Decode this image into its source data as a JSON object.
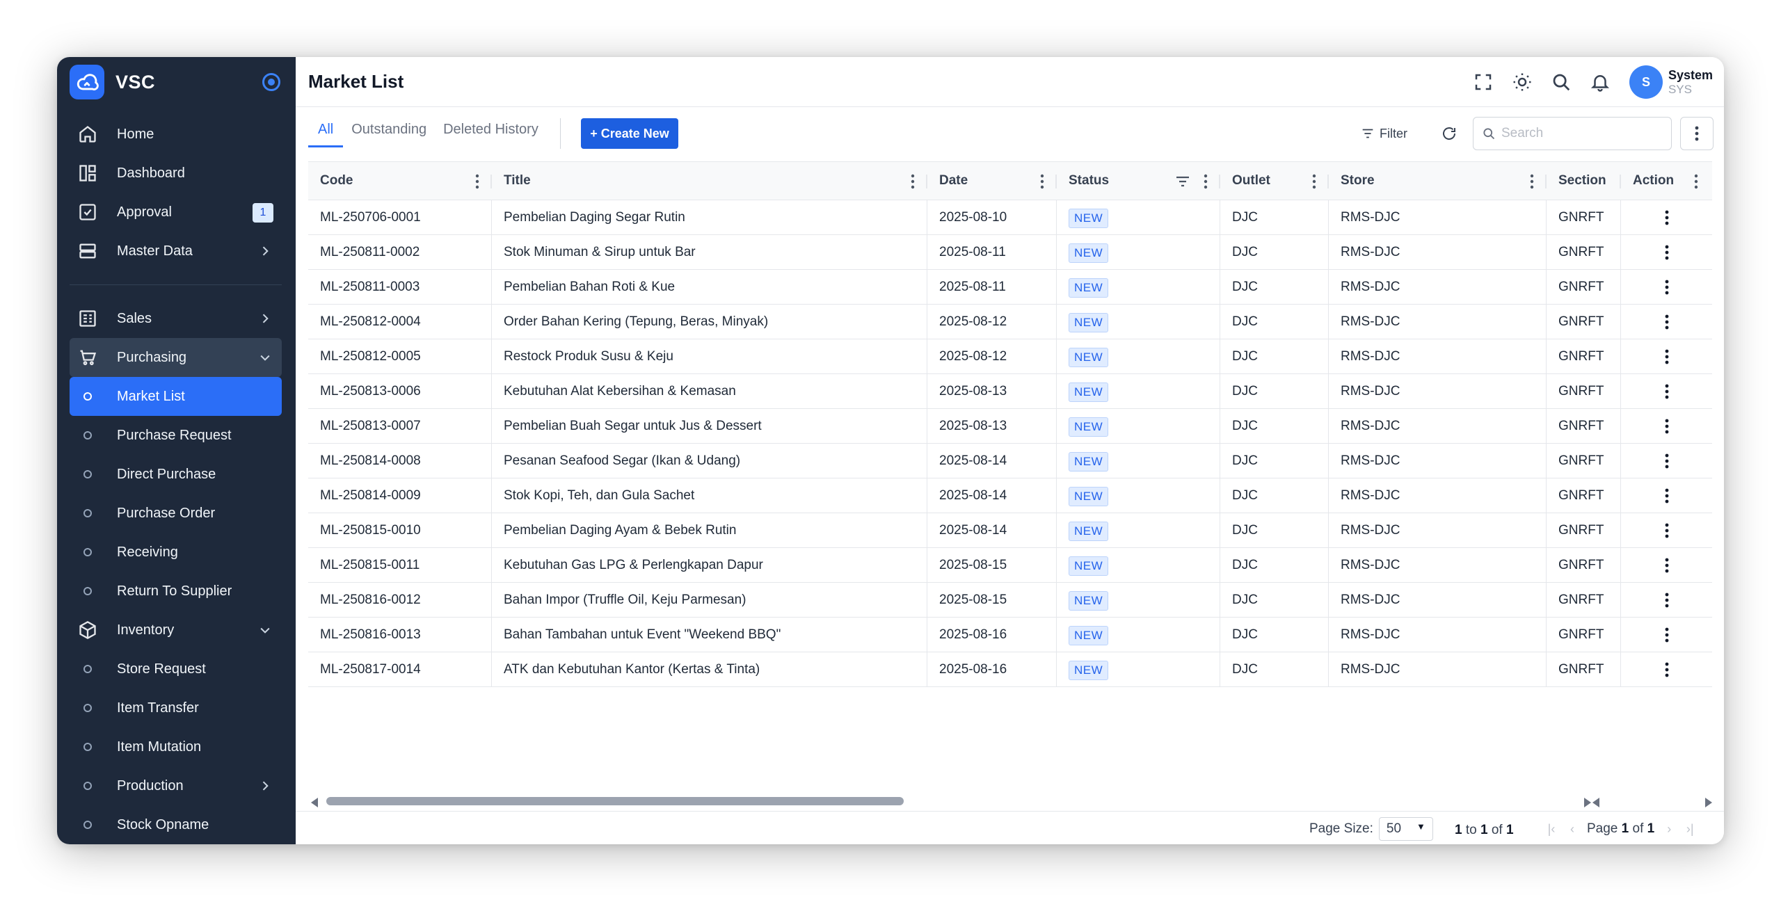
{
  "brand": {
    "name": "VSC"
  },
  "sidebar": {
    "items": [
      {
        "label": "Home",
        "icon": "home-icon"
      },
      {
        "label": "Dashboard",
        "icon": "dashboard-icon"
      },
      {
        "label": "Approval",
        "icon": "approval-icon",
        "badge": "1"
      },
      {
        "label": "Master Data",
        "icon": "database-icon"
      },
      {
        "label": "Sales",
        "icon": "sales-icon"
      },
      {
        "label": "Purchasing",
        "icon": "cart-icon"
      },
      {
        "label": "Market List"
      },
      {
        "label": "Purchase Request"
      },
      {
        "label": "Direct Purchase"
      },
      {
        "label": "Purchase Order"
      },
      {
        "label": "Receiving"
      },
      {
        "label": "Return To Supplier"
      },
      {
        "label": "Inventory",
        "icon": "box-icon"
      },
      {
        "label": "Store Request"
      },
      {
        "label": "Item Transfer"
      },
      {
        "label": "Item Mutation"
      },
      {
        "label": "Production"
      },
      {
        "label": "Stock Opname"
      }
    ]
  },
  "header": {
    "title": "Market List"
  },
  "user": {
    "initial": "S",
    "name": "System",
    "code": "SYS"
  },
  "tabs": [
    {
      "label": "All"
    },
    {
      "label": "Outstanding"
    },
    {
      "label": "Deleted History"
    }
  ],
  "toolbar": {
    "create_label": "+ Create New",
    "filter_label": "Filter",
    "search_placeholder": "Search"
  },
  "grid": {
    "columns": [
      "Code",
      "Title",
      "Date",
      "Status",
      "Outlet",
      "Store",
      "Section",
      "Action"
    ],
    "rows": [
      {
        "code": "ML-250706-0001",
        "title": "Pembelian Daging Segar Rutin",
        "date": "2025-08-10",
        "status": "NEW",
        "outlet": "DJC",
        "store": "RMS-DJC",
        "section": "GNRFT"
      },
      {
        "code": "ML-250811-0002",
        "title": "Stok Minuman & Sirup untuk Bar",
        "date": "2025-08-11",
        "status": "NEW",
        "outlet": "DJC",
        "store": "RMS-DJC",
        "section": "GNRFT"
      },
      {
        "code": "ML-250811-0003",
        "title": "Pembelian Bahan Roti & Kue",
        "date": "2025-08-11",
        "status": "NEW",
        "outlet": "DJC",
        "store": "RMS-DJC",
        "section": "GNRFT"
      },
      {
        "code": "ML-250812-0004",
        "title": "Order Bahan Kering (Tepung, Beras, Minyak)",
        "date": "2025-08-12",
        "status": "NEW",
        "outlet": "DJC",
        "store": "RMS-DJC",
        "section": "GNRFT"
      },
      {
        "code": "ML-250812-0005",
        "title": "Restock Produk Susu & Keju",
        "date": "2025-08-12",
        "status": "NEW",
        "outlet": "DJC",
        "store": "RMS-DJC",
        "section": "GNRFT"
      },
      {
        "code": "ML-250813-0006",
        "title": "Kebutuhan Alat Kebersihan & Kemasan",
        "date": "2025-08-13",
        "status": "NEW",
        "outlet": "DJC",
        "store": "RMS-DJC",
        "section": "GNRFT"
      },
      {
        "code": "ML-250813-0007",
        "title": "Pembelian Buah Segar untuk Jus & Dessert",
        "date": "2025-08-13",
        "status": "NEW",
        "outlet": "DJC",
        "store": "RMS-DJC",
        "section": "GNRFT"
      },
      {
        "code": "ML-250814-0008",
        "title": "Pesanan Seafood Segar (Ikan & Udang)",
        "date": "2025-08-14",
        "status": "NEW",
        "outlet": "DJC",
        "store": "RMS-DJC",
        "section": "GNRFT"
      },
      {
        "code": "ML-250814-0009",
        "title": "Stok Kopi, Teh, dan Gula Sachet",
        "date": "2025-08-14",
        "status": "NEW",
        "outlet": "DJC",
        "store": "RMS-DJC",
        "section": "GNRFT"
      },
      {
        "code": "ML-250815-0010",
        "title": "Pembelian Daging Ayam & Bebek Rutin",
        "date": "2025-08-14",
        "status": "NEW",
        "outlet": "DJC",
        "store": "RMS-DJC",
        "section": "GNRFT"
      },
      {
        "code": "ML-250815-0011",
        "title": "Kebutuhan Gas LPG & Perlengkapan Dapur",
        "date": "2025-08-15",
        "status": "NEW",
        "outlet": "DJC",
        "store": "RMS-DJC",
        "section": "GNRFT"
      },
      {
        "code": "ML-250816-0012",
        "title": "Bahan Impor (Truffle Oil, Keju Parmesan)",
        "date": "2025-08-15",
        "status": "NEW",
        "outlet": "DJC",
        "store": "RMS-DJC",
        "section": "GNRFT"
      },
      {
        "code": "ML-250816-0013",
        "title": "Bahan Tambahan untuk Event \"Weekend BBQ\"",
        "date": "2025-08-16",
        "status": "NEW",
        "outlet": "DJC",
        "store": "RMS-DJC",
        "section": "GNRFT"
      },
      {
        "code": "ML-250817-0014",
        "title": "ATK dan Kebutuhan Kantor (Kertas & Tinta)",
        "date": "2025-08-16",
        "status": "NEW",
        "outlet": "DJC",
        "store": "RMS-DJC",
        "section": "GNRFT"
      }
    ]
  },
  "pagination": {
    "page_size_label": "Page Size:",
    "page_size": "50",
    "range_from": "1",
    "range_to_word": "to",
    "range_to": "1",
    "of_word": "of",
    "total": "1",
    "page_word": "Page",
    "current_page": "1",
    "total_pages": "1"
  },
  "colors": {
    "sidebar_bg": "#1e293b",
    "accent": "#2b6ef7",
    "badge_bg": "#e0ecff"
  }
}
